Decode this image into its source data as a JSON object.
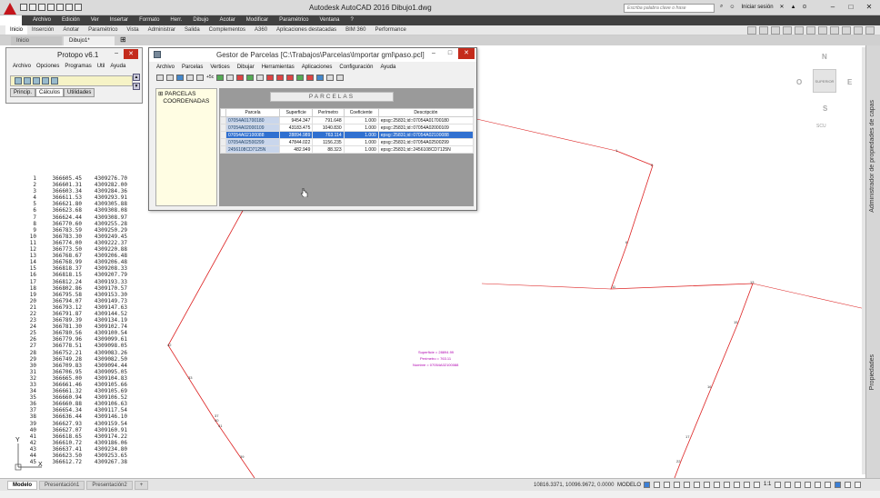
{
  "app": {
    "title": "Autodesk AutoCAD 2016   Dibujo1.dwg",
    "search_placeholder": "Escriba palabra clave o frase",
    "signin": "Iniciar sesión",
    "help": "?"
  },
  "menubar": [
    "Archivo",
    "Edición",
    "Ver",
    "Insertar",
    "Formato",
    "Herr.",
    "Dibujo",
    "Acotar",
    "Modificar",
    "Paramétrico",
    "Ventana",
    "?"
  ],
  "ribbon_tabs": [
    "Inicio",
    "Inserción",
    "Anotar",
    "Paramétrico",
    "Vista",
    "Administrar",
    "Salida",
    "Complementos",
    "A360",
    "Aplicaciones destacadas",
    "BIM 360",
    "Performance"
  ],
  "doc_tabs": [
    "Inicio",
    "Dibujo1*"
  ],
  "viewcube": {
    "n": "N",
    "s": "S",
    "e": "E",
    "o": "O",
    "center": "SUPERIOR",
    "scu": "SCU"
  },
  "side_labels": {
    "top": "Administrador de propiedades de capas",
    "bottom": "Propiedades"
  },
  "protopo": {
    "title": "Protopo v6.1",
    "menu": [
      "Archivo",
      "Opciones",
      "Programas",
      "Util",
      "Ayuda"
    ],
    "tabs": [
      "Princip.",
      "Cálculos",
      "Utilidades"
    ]
  },
  "gestor": {
    "title": "Gestor de Parcelas [C:\\Trabajos\\Parcelas\\Importar gml\\paso.pcl]",
    "menu": [
      "Archivo",
      "Parcelas",
      "Vertices",
      "Dibujar",
      "Herramientas",
      "Aplicaciones",
      "Configuración",
      "Ayuda"
    ],
    "tool_text": "+5c",
    "tree": [
      "PARCELAS",
      "COORDENADAS"
    ],
    "header": "PARCELAS",
    "columns": [
      "Parcela",
      "Superficie",
      "Perímetro",
      "Coeficiente",
      "Descripción"
    ],
    "rows": [
      [
        "07054A01700180",
        "9454.347",
        "791.648",
        "1.000",
        "epsg::25831;id::07054A01700180"
      ],
      [
        "07054A02000109",
        "43183.475",
        "1040.830",
        "1.000",
        "epsg::25831;id::07054A02000109"
      ],
      [
        "07054A02100088",
        "28894.989",
        "763.114",
        "1.000",
        "epsg::25831;id::07054A02100088"
      ],
      [
        "07054A02500299",
        "47844.022",
        "1156.235",
        "1.000",
        "epsg::25831;id::07054A02500299"
      ],
      [
        "2456108CD7125N",
        "482.949",
        "88.323",
        "1.000",
        "epsg::25831;id::2456108CD7125N"
      ]
    ],
    "selected_row": 2
  },
  "annotation": {
    "superficie": "Superficie = 28894.99",
    "perimetro": "Perímetro = 763.11",
    "nombre": "Nombre = 07054A02100088"
  },
  "point_labels": [
    "1",
    "2",
    "6",
    "11",
    "13",
    "15",
    "16",
    "17",
    "22",
    "33",
    "37",
    "39",
    "40",
    "41",
    "42"
  ],
  "coords": [
    [
      "1",
      "366605.45",
      "4309276.70"
    ],
    [
      "2",
      "366601.31",
      "4309282.00"
    ],
    [
      "3",
      "366603.34",
      "4309284.36"
    ],
    [
      "4",
      "366611.53",
      "4309293.91"
    ],
    [
      "5",
      "366621.80",
      "4309305.88"
    ],
    [
      "6",
      "366623.68",
      "4309308.08"
    ],
    [
      "7",
      "366624.44",
      "4309308.97"
    ],
    [
      "8",
      "366770.60",
      "4309255.28"
    ],
    [
      "9",
      "366783.59",
      "4309250.29"
    ],
    [
      "10",
      "366783.30",
      "4309249.45"
    ],
    [
      "11",
      "366774.00",
      "4309222.37"
    ],
    [
      "12",
      "366773.50",
      "4309220.88"
    ],
    [
      "13",
      "366768.67",
      "4309206.48"
    ],
    [
      "14",
      "366768.99",
      "4309206.48"
    ],
    [
      "15",
      "366818.37",
      "4309208.33"
    ],
    [
      "16",
      "366818.15",
      "4309207.79"
    ],
    [
      "17",
      "366812.24",
      "4309193.33"
    ],
    [
      "18",
      "366802.86",
      "4309170.57"
    ],
    [
      "19",
      "366795.58",
      "4309153.30"
    ],
    [
      "20",
      "366794.07",
      "4309149.73"
    ],
    [
      "21",
      "366793.12",
      "4309147.63"
    ],
    [
      "22",
      "366791.87",
      "4309144.52"
    ],
    [
      "23",
      "366789.39",
      "4309134.19"
    ],
    [
      "24",
      "366781.30",
      "4309102.74"
    ],
    [
      "25",
      "366780.56",
      "4309100.54"
    ],
    [
      "26",
      "366779.96",
      "4309099.61"
    ],
    [
      "27",
      "366778.51",
      "4309098.05"
    ],
    [
      "28",
      "366752.21",
      "4309083.26"
    ],
    [
      "29",
      "366749.28",
      "4309082.50"
    ],
    [
      "30",
      "366709.83",
      "4309094.44"
    ],
    [
      "31",
      "366706.95",
      "4309095.05"
    ],
    [
      "32",
      "366665.00",
      "4309104.83"
    ],
    [
      "33",
      "366661.46",
      "4309105.66"
    ],
    [
      "34",
      "366661.32",
      "4309105.69"
    ],
    [
      "35",
      "366660.94",
      "4309106.52"
    ],
    [
      "36",
      "366660.88",
      "4309106.63"
    ],
    [
      "37",
      "366654.34",
      "4309117.54"
    ],
    [
      "38",
      "366636.44",
      "4309146.10"
    ],
    [
      "39",
      "366627.93",
      "4309159.54"
    ],
    [
      "40",
      "366627.07",
      "4309160.91"
    ],
    [
      "41",
      "366618.65",
      "4309174.22"
    ],
    [
      "42",
      "366610.72",
      "4309186.06"
    ],
    [
      "43",
      "366637.41",
      "4309234.80"
    ],
    [
      "44",
      "366623.50",
      "4309253.65"
    ],
    [
      "45",
      "366612.72",
      "4309267.38"
    ]
  ],
  "ucs": {
    "y": "Y",
    "x": "X"
  },
  "status": {
    "layouts": [
      "Modelo",
      "Presentación1",
      "Presentación2"
    ],
    "coords": "10816.3371, 10096.9672, 0.0000",
    "mode": "MODELO",
    "scale": "1:1"
  }
}
